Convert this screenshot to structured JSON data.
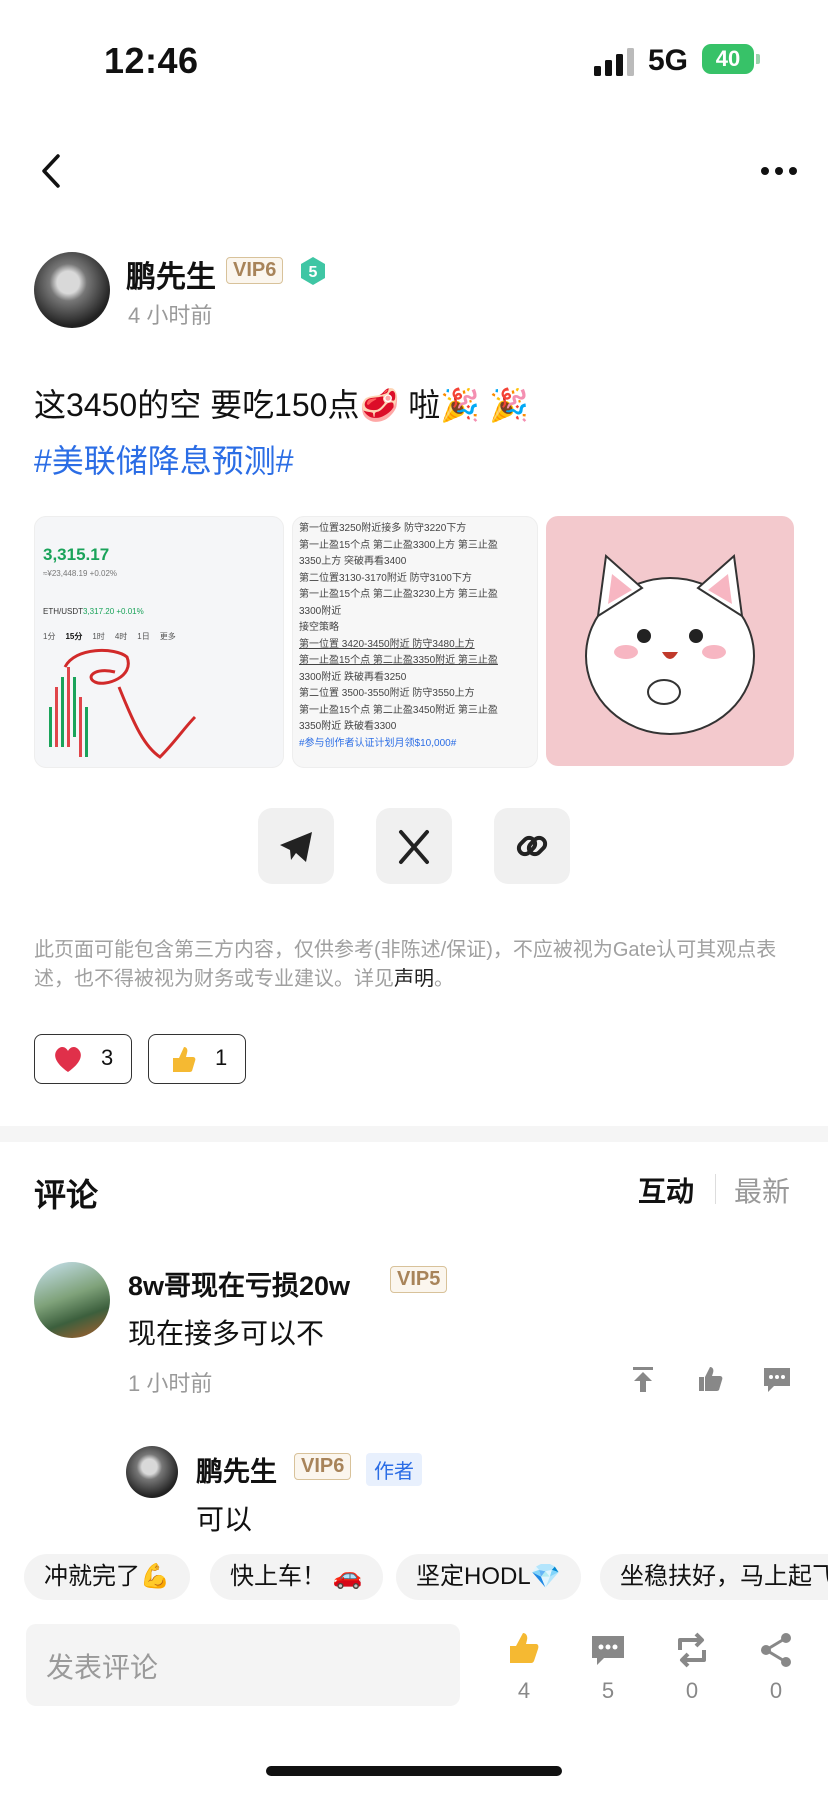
{
  "status_bar": {
    "time": "12:46",
    "network": "5G",
    "battery": "40"
  },
  "post": {
    "author": {
      "name": "鹏先生",
      "vip": "VIP6",
      "level": "5"
    },
    "time": "4 小时前",
    "text": "这3450的空 要吃150点🥩 啦🎉 🎉",
    "hashtag": "#美联储降息预测#",
    "images": [
      {
        "kind": "chart-screenshot",
        "price": "3,315.17",
        "sub": "≈¥23,448.19 +0.02%",
        "pair": "ETH/USDT",
        "pair_price": "3,317.20 +0.01%",
        "tabs": [
          "1分",
          "15分",
          "1时",
          "4时",
          "1日",
          "更多"
        ]
      },
      {
        "kind": "text-screenshot",
        "lines": [
          "第一位置3250附近接多 防守3220下方",
          "第一止盈15个点 第二止盈3300上方 第三止盈",
          "3350上方 突破再看3400",
          "第二位置3130-3170附近 防守3100下方",
          "第一止盈15个点 第二止盈3230上方 第三止盈",
          "3300附近",
          "接空策略",
          "第一位置 3420-3450附近 防守3480上方",
          "第一止盈15个点 第二止盈3350附近 第三止盈",
          "3300附近 跌破再看3250",
          "第二位置 3500-3550附近 防守3550上方",
          "第一止盈15个点 第二止盈3450附近 第三止盈",
          "3350附近 跌破看3300",
          "#参与创作者认证计划月领$10,000#"
        ]
      },
      {
        "kind": "sticker"
      }
    ],
    "disclaimer": "此页面可能包含第三方内容，仅供参考(非陈述/保证)，不应被视为Gate认可其观点表述，也不得被视为财务或专业建议。详见",
    "disclaimer_link": "声明",
    "disclaimer_end": "。",
    "reactions": [
      {
        "icon": "heart-icon",
        "count": "3"
      },
      {
        "icon": "thumbs-up-icon",
        "count": "1"
      }
    ]
  },
  "share_buttons": [
    "telegram-icon",
    "x-icon",
    "link-icon"
  ],
  "comments_section": {
    "title": "评论",
    "sort_active": "互动",
    "sort_inactive": "最新",
    "comments": [
      {
        "name": "8w哥现在亏损20w",
        "vip": "VIP5",
        "text": "现在接多可以不",
        "time": "1 小时前",
        "reply": {
          "name": "鹏先生",
          "vip": "VIP6",
          "tag": "作者",
          "text": "可以"
        }
      }
    ]
  },
  "quick_replies": [
    "冲就完了💪",
    "快上车！ 🚗",
    "坚定HODL💎",
    "坐稳扶好，马上起飞"
  ],
  "bottom_bar": {
    "input_placeholder": "发表评论",
    "likes": "4",
    "comments": "5",
    "reposts": "0",
    "shares": "0"
  },
  "colors": {
    "link": "#2b6de5",
    "vip_border": "#d8c29a",
    "battery": "#37c268"
  }
}
